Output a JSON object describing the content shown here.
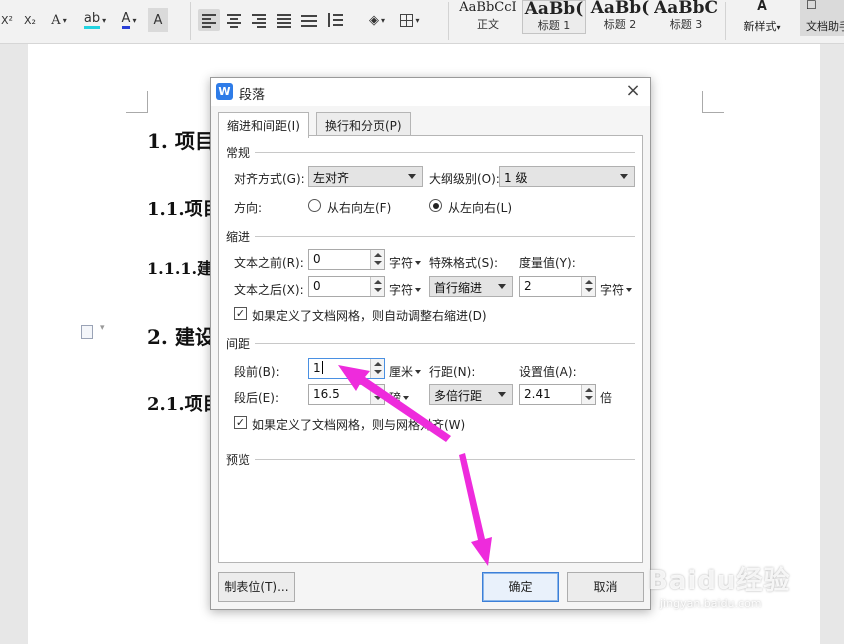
{
  "toolbar": {
    "superscript_label": "X²",
    "subscript_label": "X₂",
    "font_effect_label": "A",
    "highlight_label": "ab",
    "font_color_label": "A",
    "char_shading_label": "A",
    "styles": [
      {
        "sample": "AaBbCcI",
        "name": "正文"
      },
      {
        "sample": "AaBb(",
        "name": "标题 1"
      },
      {
        "sample": "AaBb(",
        "name": "标题 2"
      },
      {
        "sample": "AaBbC",
        "name": "标题 3"
      }
    ],
    "new_style_label": "新样式",
    "doc_assistant_label": "文档助手"
  },
  "document": {
    "headings": [
      "1. 项目",
      "1.1.项目",
      "1.1.1.建",
      "2. 建设",
      "2.1.项目"
    ]
  },
  "dialog": {
    "title": "段落",
    "app_icon_glyph": "W",
    "close_glyph": "×",
    "tabs": [
      "缩进和间距(I)",
      "换行和分页(P)"
    ],
    "general": {
      "title": "常规",
      "alignment_label": "对齐方式(G):",
      "alignment_value": "左对齐",
      "outline_label": "大纲级别(O):",
      "outline_value": "1 级",
      "direction_label": "方向:",
      "rtl_label": "从右向左(F)",
      "ltr_label": "从左向右(L)"
    },
    "indent": {
      "title": "缩进",
      "before_label": "文本之前(R):",
      "before_value": "0",
      "before_unit": "字符",
      "after_label": "文本之后(X):",
      "after_value": "0",
      "after_unit": "字符",
      "special_label": "特殊格式(S):",
      "special_value": "首行缩进",
      "measure_label": "度量值(Y):",
      "measure_value": "2",
      "measure_unit": "字符",
      "grid_checkbox_label": "如果定义了文档网格，则自动调整右缩进(D)"
    },
    "spacing": {
      "title": "间距",
      "before_label": "段前(B):",
      "before_value": "1",
      "before_unit": "厘米",
      "after_label": "段后(E):",
      "after_value": "16.5",
      "after_unit": "磅",
      "line_spacing_label": "行距(N):",
      "line_spacing_value": "多倍行距",
      "setting_label": "设置值(A):",
      "setting_value": "2.41",
      "setting_unit": "倍",
      "grid_checkbox_label": "如果定义了文档网格，则与网格对齐(W)"
    },
    "preview_title": "预览",
    "tab_stops_button": "制表位(T)...",
    "ok_button": "确定",
    "cancel_button": "取消"
  },
  "annotation_color": "#ee2bdc",
  "watermark": {
    "text": "Baidu经验",
    "url": "jingyan.baidu.com"
  }
}
